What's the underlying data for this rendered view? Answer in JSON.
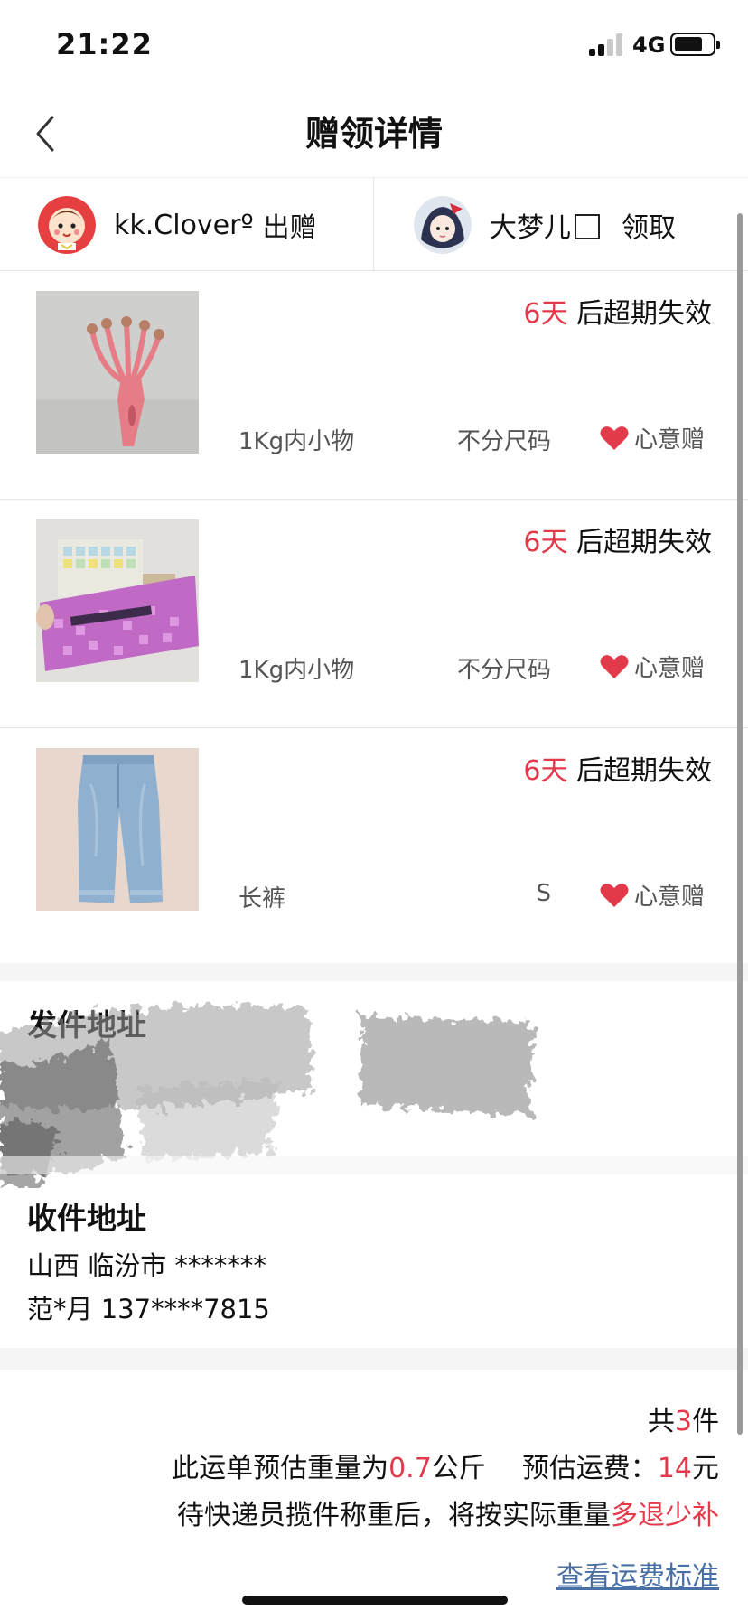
{
  "status_bar": {
    "time": "21:22",
    "network": "4G"
  },
  "nav": {
    "title": "赠领详情"
  },
  "giver": {
    "name": "kk.Cloverº",
    "action": "出赠"
  },
  "receiver": {
    "name": "大梦儿",
    "action": "领取"
  },
  "items": [
    {
      "days": "6天",
      "expiry_suffix": " 后超期失效",
      "category": "1Kg内小物",
      "size": "不分尺码",
      "gift_label": "心意赠",
      "thumb": "head-massager"
    },
    {
      "days": "6天",
      "expiry_suffix": " 后超期失效",
      "category": "1Kg内小物",
      "size": "不分尺码",
      "gift_label": "心意赠",
      "thumb": "craft-box"
    },
    {
      "days": "6天",
      "expiry_suffix": " 后超期失效",
      "category": "长裤",
      "size": "S",
      "gift_label": "心意赠",
      "thumb": "jeans"
    }
  ],
  "sender_address": {
    "title": "发件地址"
  },
  "receiver_address": {
    "title": "收件地址",
    "line1": "山西 临汾市 *******",
    "line2": "范*月 137****7815"
  },
  "summary": {
    "count_prefix": "共",
    "count": "3",
    "count_suffix": "件",
    "weight_prefix": "此运单预估重量为",
    "weight": "0.7",
    "weight_unit": "公斤",
    "fee_prefix": "预估运费：",
    "fee": "14",
    "fee_unit": "元",
    "note_prefix": "待快递员揽件称重后，将按实际重量",
    "note_highlight": "多退少补",
    "fee_link": "查看运费标准"
  },
  "colors": {
    "accent_red": "#e2394b",
    "link_blue": "#4a6fa5"
  }
}
